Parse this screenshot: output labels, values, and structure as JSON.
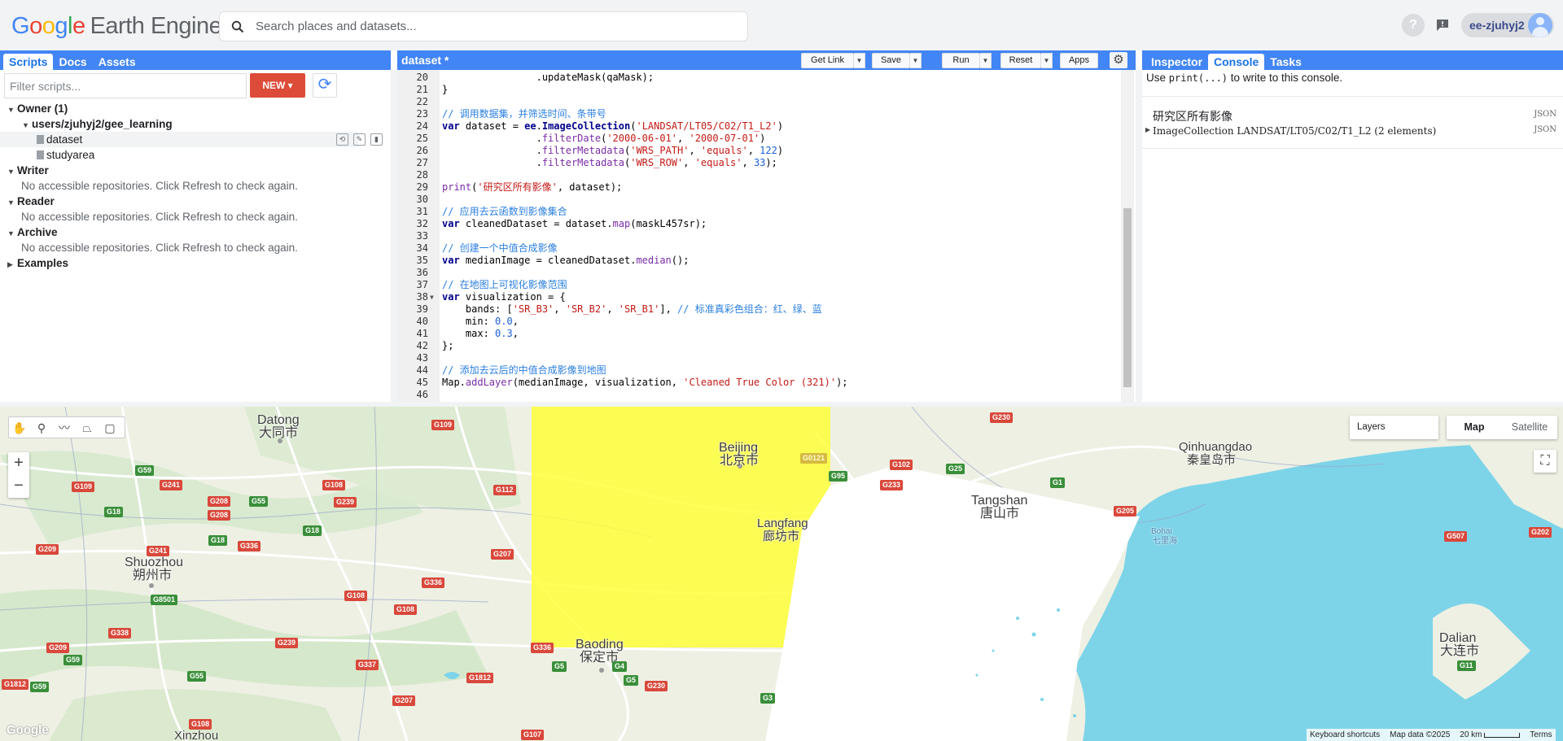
{
  "header": {
    "logo_google": [
      "G",
      "o",
      "o",
      "g",
      "l",
      "e"
    ],
    "logo_product": "Earth Engine",
    "search_placeholder": "Search places and datasets...",
    "username": "ee-zjuhyj2"
  },
  "left_panel": {
    "tabs": [
      "Scripts",
      "Docs",
      "Assets"
    ],
    "filter_placeholder": "Filter scripts...",
    "new_button": "NEW",
    "tree": {
      "owner": "Owner (1)",
      "repo": "users/zjuhyj2/gee_learning",
      "files": [
        "dataset",
        "studyarea"
      ],
      "writer": "Writer",
      "writer_msg": "No accessible repositories. Click Refresh to check again.",
      "reader": "Reader",
      "reader_msg": "No accessible repositories. Click Refresh to check again.",
      "archive": "Archive",
      "archive_msg": "No accessible repositories. Click Refresh to check again.",
      "examples": "Examples"
    }
  },
  "editor": {
    "script_name": "dataset *",
    "buttons": {
      "get_link": "Get Link",
      "save": "Save",
      "run": "Run",
      "reset": "Reset",
      "apps": "Apps"
    },
    "lines": [
      {
        "n": "20",
        "html": "                .updateMask(qaMask);"
      },
      {
        "n": "21",
        "html": "}"
      },
      {
        "n": "22",
        "html": ""
      },
      {
        "n": "23",
        "html": "<span class=\"cm\">// 调用数据集，并筛选时间、条带号</span>"
      },
      {
        "n": "24",
        "html": "<span class=\"kw\">var</span> dataset = <span class=\"kw\">ee</span>.<span class=\"kw\">ImageCollection</span>(<span class=\"st\">'LANDSAT/LT05/C02/T1_L2'</span>)"
      },
      {
        "n": "25",
        "html": "                .<span class=\"fn\">filterDate</span>(<span class=\"st\">'2000-06-01'</span>, <span class=\"st\">'2000-07-01'</span>)"
      },
      {
        "n": "26",
        "html": "                .<span class=\"fn\">filterMetadata</span>(<span class=\"st\">'WRS_PATH'</span>, <span class=\"st\">'equals'</span>, <span class=\"nu\">122</span>)"
      },
      {
        "n": "27",
        "html": "                .<span class=\"fn\">filterMetadata</span>(<span class=\"st\">'WRS_ROW'</span>, <span class=\"st\">'equals'</span>, <span class=\"nu\">33</span>);"
      },
      {
        "n": "28",
        "html": ""
      },
      {
        "n": "29",
        "html": "<span class=\"fn\">print</span>(<span class=\"st\">'研究区所有影像'</span>, dataset);"
      },
      {
        "n": "30",
        "html": ""
      },
      {
        "n": "31",
        "html": "<span class=\"cm\">// 应用去云函数到影像集合</span>"
      },
      {
        "n": "32",
        "html": "<span class=\"kw\">var</span> cleanedDataset = dataset.<span class=\"fn\">map</span>(maskL457sr);"
      },
      {
        "n": "33",
        "html": ""
      },
      {
        "n": "34",
        "html": "<span class=\"cm\">// 创建一个中值合成影像</span>"
      },
      {
        "n": "35",
        "html": "<span class=\"kw\">var</span> medianImage = cleanedDataset.<span class=\"fn\">median</span>();"
      },
      {
        "n": "36",
        "html": ""
      },
      {
        "n": "37",
        "html": "<span class=\"cm\">// 在地图上可视化影像范围</span>"
      },
      {
        "n": "38",
        "html": "<span class=\"kw\">var</span> visualization = {",
        "fold": true
      },
      {
        "n": "39",
        "html": "    bands: [<span class=\"st\">'SR_B3'</span>, <span class=\"st\">'SR_B2'</span>, <span class=\"st\">'SR_B1'</span>], <span class=\"cm\">// 标准真彩色组合：红、绿、蓝</span>"
      },
      {
        "n": "40",
        "html": "    min: <span class=\"nu\">0.0</span>,"
      },
      {
        "n": "41",
        "html": "    max: <span class=\"nu\">0.3</span>,"
      },
      {
        "n": "42",
        "html": "};"
      },
      {
        "n": "43",
        "html": ""
      },
      {
        "n": "44",
        "html": "<span class=\"cm\">// 添加去云后的中值合成影像到地图</span>"
      },
      {
        "n": "45",
        "html": "Map.<span class=\"fn\">addLayer</span>(medianImage, visualization, <span class=\"st\">'Cleaned True Color (321)'</span>);"
      },
      {
        "n": "46",
        "html": ""
      }
    ]
  },
  "right_panel": {
    "tabs": [
      "Inspector",
      "Console",
      "Tasks"
    ],
    "hint_prefix": "Use ",
    "hint_code": "print(...)",
    "hint_suffix": " to write to this console.",
    "output_label": "研究区所有影像",
    "output_collection": "ImageCollection LANDSAT/LT05/C02/T1_L2 (2 elements)",
    "json_tag": "JSON"
  },
  "map": {
    "layers_label": "Layers",
    "map_type": [
      "Map",
      "Satellite"
    ],
    "attribution": [
      "Keyboard shortcuts",
      "Map data ©2025",
      "20 km",
      "Terms"
    ],
    "google_mark": "Google",
    "places": [
      {
        "en": "Datong",
        "zh": "大同市"
      },
      {
        "en": "Beijing",
        "zh": "北京市"
      },
      {
        "en": "Langfang",
        "zh": "廊坊市"
      },
      {
        "en": "Tangshan",
        "zh": "唐山市"
      },
      {
        "en": "Qinhuangdao",
        "zh": "秦皇岛市"
      },
      {
        "en": "Shuozhou",
        "zh": "朔州市"
      },
      {
        "en": "Baoding",
        "zh": "保定市"
      },
      {
        "en": "Dalian",
        "zh": "大连市"
      },
      {
        "en": "Xinzhou",
        "zh": ""
      },
      {
        "en": "Bohai",
        "zh": "七里海"
      }
    ],
    "roads": [
      "G109",
      "G59",
      "G241",
      "G55",
      "G239",
      "G112",
      "G18",
      "G208",
      "G336",
      "G207",
      "G109",
      "G18",
      "G5",
      "G336",
      "G108",
      "G8501",
      "G108",
      "G239",
      "G337",
      "G338",
      "G209",
      "G59",
      "G55",
      "G1812",
      "G59",
      "G108",
      "G207",
      "G107",
      "G1812",
      "G5",
      "G4",
      "G230",
      "G3",
      "G102",
      "G233",
      "G25",
      "G1",
      "G205",
      "G230",
      "G507",
      "G202",
      "G11",
      "G95",
      "G0121",
      "G336",
      "G209",
      "G108",
      "G208",
      "G241",
      "G18"
    ],
    "colors": {
      "overlay": "#ffff33",
      "sea": "#7dd4e8",
      "land": "#eef0e4"
    }
  }
}
